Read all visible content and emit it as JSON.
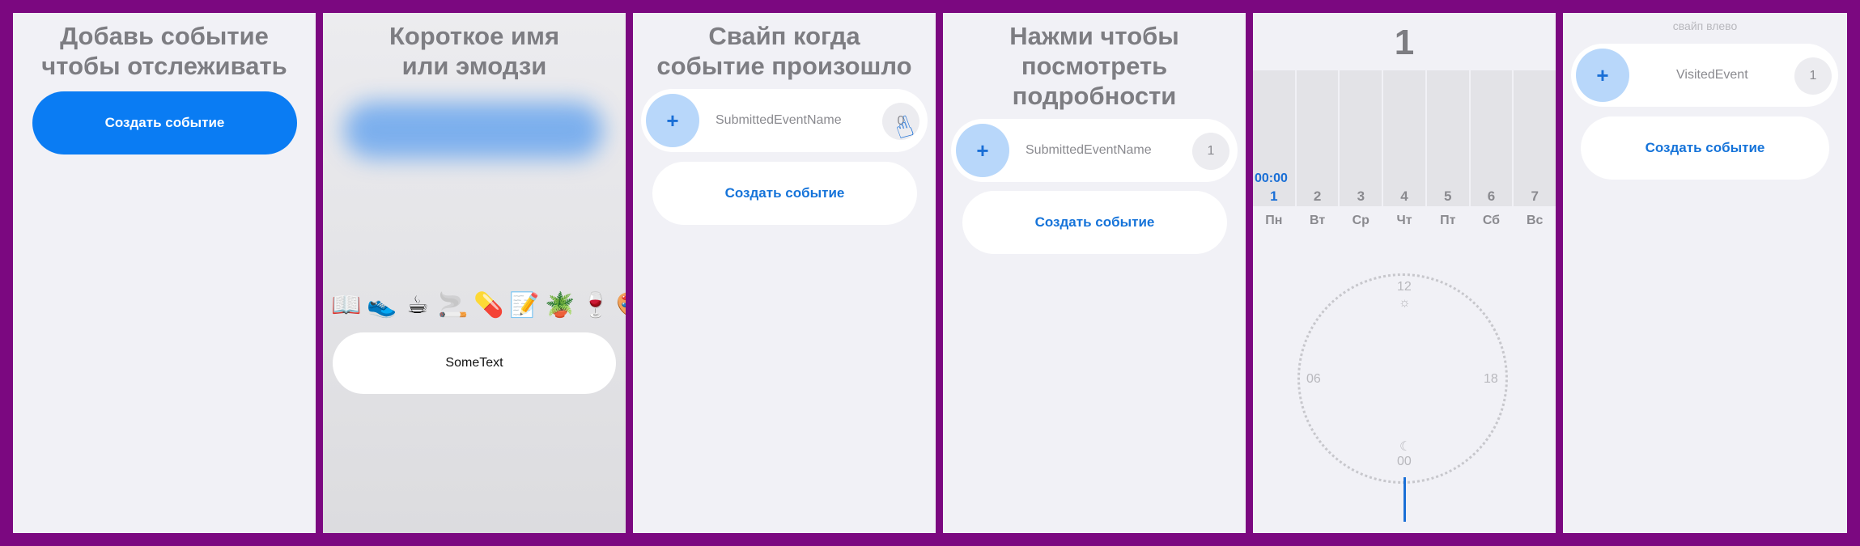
{
  "panels": [
    {
      "title": "Добавь событие\nчтобы отслеживать",
      "button": "Создать событие"
    },
    {
      "title": "Короткое имя\nили эмодзи",
      "input_value": "SomeText"
    },
    {
      "title": "Свайп когда\nсобытие произошло",
      "event_name": "SubmittedEventName",
      "count": "0",
      "button": "Создать событие"
    },
    {
      "title": "Нажми чтобы\nпосмотреть\nподробности",
      "event_name": "SubmittedEventName",
      "count": "1",
      "button": "Создать событие"
    },
    {
      "big_number": "1",
      "time": "00:00",
      "day_numbers": [
        "1",
        "2",
        "3",
        "4",
        "5",
        "6",
        "7"
      ],
      "day_labels": [
        "Пн",
        "Вт",
        "Ср",
        "Чт",
        "Пт",
        "Сб",
        "Вс"
      ],
      "clock_labels": {
        "top": "12",
        "left": "06",
        "right": "18",
        "bottom": "00"
      }
    },
    {
      "hint": "свайп влево",
      "event_name": "VisitedEvent",
      "count": "1",
      "button": "Создать событие"
    }
  ],
  "emojis": [
    "📖",
    "👟",
    "☕",
    "🚬",
    "💊",
    "📝",
    "🪴",
    "🍷",
    "🎨"
  ],
  "icons": {
    "plus": "+",
    "sun": "☼",
    "moon": "☾",
    "hand": "☝"
  },
  "colors": {
    "accent": "#0a7cf3",
    "frame": "#7b0880"
  }
}
